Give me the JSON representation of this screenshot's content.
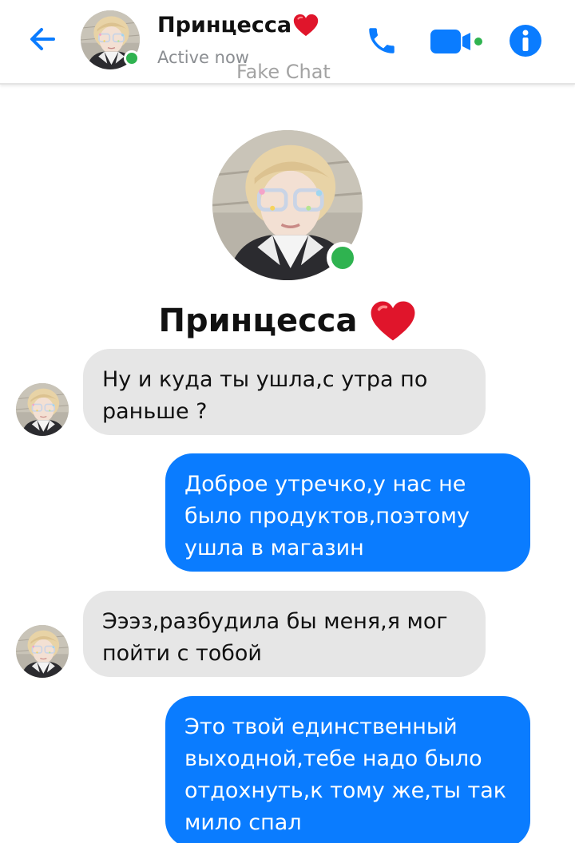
{
  "header": {
    "contact_name": "Принцесса",
    "status": "Active now",
    "watermark": "Fake Chat"
  },
  "profile": {
    "name": "Принцесса"
  },
  "icons": {
    "back": "arrow-left-icon",
    "call": "phone-icon",
    "video": "video-camera-icon",
    "info": "info-icon",
    "heart": "red-heart-emoji"
  },
  "colors": {
    "accent": "#0a7cff",
    "incoming_bubble": "#e6e6e6",
    "online": "#2fb350",
    "heart": "#e0152b"
  },
  "messages": [
    {
      "direction": "incoming",
      "lines": [
        "Ну и куда ты ушла,с утра по",
        "раньше ?"
      ]
    },
    {
      "direction": "outgoing",
      "lines": [
        "Доброе утречко,у нас не",
        "было продуктов,поэтому",
        "ушла в магазин"
      ]
    },
    {
      "direction": "incoming",
      "lines": [
        "Эээз,разбудила бы меня,я мог",
        "пойти с тобой"
      ]
    },
    {
      "direction": "outgoing",
      "lines": [
        "Это твой единственный",
        "выходной,тебе надо было",
        "отдохнуть,к тому же,ты так",
        "мило спал"
      ]
    }
  ]
}
